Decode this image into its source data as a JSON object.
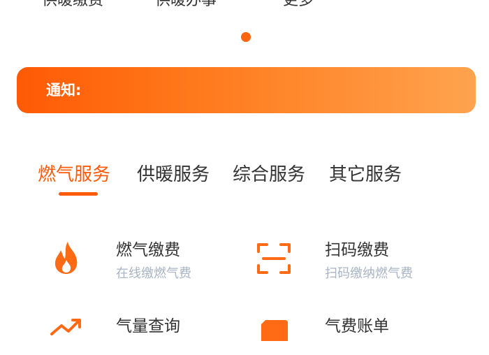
{
  "top_nav": {
    "items": [
      {
        "label": "供暖缴费"
      },
      {
        "label": "供暖办事"
      },
      {
        "label": "更多"
      }
    ]
  },
  "notice": {
    "label": "通知:"
  },
  "tabs": [
    {
      "label": "燃气服务",
      "active": true
    },
    {
      "label": "供暖服务",
      "active": false
    },
    {
      "label": "综合服务",
      "active": false
    },
    {
      "label": "其它服务",
      "active": false
    }
  ],
  "services": [
    {
      "title": "燃气缴费",
      "subtitle": "在线缴燃气费",
      "icon": "flame-icon"
    },
    {
      "title": "扫码缴费",
      "subtitle": "扫码缴纳燃气费",
      "icon": "scan-icon"
    },
    {
      "title": "气量查询",
      "icon": "trend-up-icon"
    },
    {
      "title": "气费账单",
      "icon": "bill-icon"
    }
  ],
  "colors": {
    "accent": "#ff5a0a",
    "notice_gradient_start": "#ff5a05",
    "notice_gradient_end": "#ffa34e",
    "subtitle": "#a8b4c4"
  }
}
